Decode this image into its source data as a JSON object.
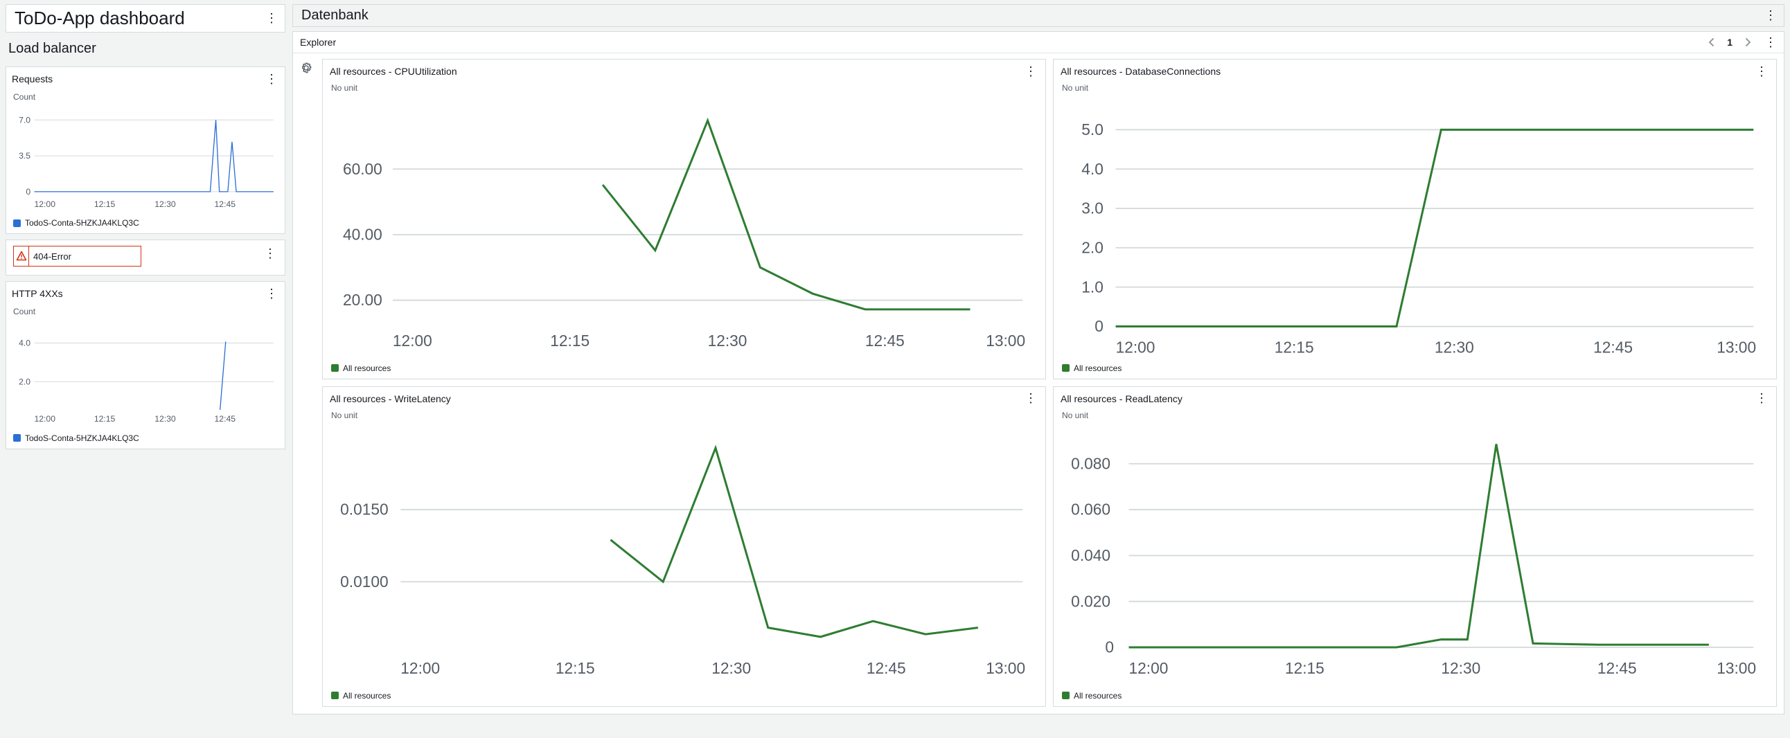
{
  "dashboard": {
    "title": "ToDo-App dashboard",
    "section_left": "Load balancer",
    "section_right": "Datenbank"
  },
  "explorer": {
    "label": "Explorer",
    "page": "1"
  },
  "alarm": {
    "label": "404-Error"
  },
  "legends": {
    "lb": "TodoS-Conta-5HZKJA4KLQ3C",
    "all": "All resources"
  },
  "axis_x_short": [
    "12:00",
    "12:15",
    "12:30",
    "12:45"
  ],
  "axis_x_long": [
    "12:00",
    "12:15",
    "12:30",
    "12:45",
    "13:00"
  ],
  "chart_data": [
    {
      "id": "requests",
      "title": "Requests",
      "type": "line",
      "unit_label": "Count",
      "x": [
        "12:00",
        "12:01",
        "12:40",
        "12:42",
        "12:43",
        "12:46",
        "12:47",
        "12:48",
        "12:49",
        "12:52"
      ],
      "series": [
        {
          "name": "TodoS-Conta-5HZKJA4KLQ3C",
          "color": "#2a6fd6",
          "values": [
            0,
            0,
            0,
            7.0,
            0,
            0,
            5.0,
            0,
            0,
            0
          ]
        }
      ],
      "ylim": [
        0,
        7.0
      ],
      "yticks": [
        0,
        3.5,
        7.0
      ],
      "xticks": [
        "12:00",
        "12:15",
        "12:30",
        "12:45"
      ]
    },
    {
      "id": "http4xx",
      "title": "HTTP 4XXs",
      "type": "line",
      "unit_label": "Count",
      "x": [
        "12:44",
        "12:45"
      ],
      "series": [
        {
          "name": "TodoS-Conta-5HZKJA4KLQ3C",
          "color": "#2a6fd6",
          "values": [
            1.0,
            4.0
          ]
        }
      ],
      "ylim": [
        0,
        4.0
      ],
      "yticks": [
        2.0,
        4.0
      ],
      "xticks": [
        "12:00",
        "12:15",
        "12:30",
        "12:45"
      ]
    },
    {
      "id": "cpu",
      "title": "All resources - CPUUtilization",
      "type": "line",
      "unit_label": "No unit",
      "x": [
        "12:20",
        "12:25",
        "12:30",
        "12:35",
        "12:40",
        "12:45",
        "12:50",
        "12:55"
      ],
      "series": [
        {
          "name": "All resources",
          "color": "#2e7d32",
          "values": [
            55,
            35,
            75,
            30,
            22,
            17,
            17,
            17
          ]
        }
      ],
      "ylim": [
        0,
        80
      ],
      "yticks": [
        20.0,
        40.0,
        60.0
      ],
      "xticks": [
        "12:00",
        "12:15",
        "12:30",
        "12:45",
        "13:00"
      ]
    },
    {
      "id": "dbconn",
      "title": "All resources - DatabaseConnections",
      "type": "line",
      "unit_label": "No unit",
      "x": [
        "12:00",
        "12:25",
        "12:27",
        "13:00"
      ],
      "series": [
        {
          "name": "All resources",
          "color": "#2e7d32",
          "values": [
            0,
            0,
            5.0,
            5.0
          ]
        }
      ],
      "ylim": [
        0,
        5.0
      ],
      "yticks": [
        0,
        1.0,
        2.0,
        3.0,
        4.0,
        5.0
      ],
      "xticks": [
        "12:00",
        "12:15",
        "12:30",
        "12:45",
        "13:00"
      ]
    },
    {
      "id": "wlat",
      "title": "All resources - WriteLatency",
      "type": "line",
      "unit_label": "No unit",
      "x": [
        "12:20",
        "12:25",
        "12:30",
        "12:35",
        "12:40",
        "12:45",
        "12:50",
        "12:55"
      ],
      "series": [
        {
          "name": "All resources",
          "color": "#2e7d32",
          "values": [
            0.013,
            0.01,
            0.0195,
            0.0068,
            0.0062,
            0.0072,
            0.0064,
            0.0068
          ]
        }
      ],
      "ylim": [
        0.005,
        0.02
      ],
      "yticks": [
        0.01,
        0.015
      ],
      "xticks": [
        "12:00",
        "12:15",
        "12:30",
        "12:45",
        "13:00"
      ]
    },
    {
      "id": "rlat",
      "title": "All resources - ReadLatency",
      "type": "line",
      "unit_label": "No unit",
      "x": [
        "12:00",
        "12:25",
        "12:28",
        "12:30",
        "12:35",
        "12:38",
        "12:45",
        "12:55"
      ],
      "series": [
        {
          "name": "All resources",
          "color": "#2e7d32",
          "values": [
            0,
            0,
            0.003,
            0.003,
            0.093,
            0.002,
            0.001,
            0.001
          ]
        }
      ],
      "ylim": [
        0,
        0.1
      ],
      "yticks": [
        0,
        0.02,
        0.04,
        0.06,
        0.08
      ],
      "xticks": [
        "12:00",
        "12:15",
        "12:30",
        "12:45",
        "13:00"
      ]
    }
  ]
}
